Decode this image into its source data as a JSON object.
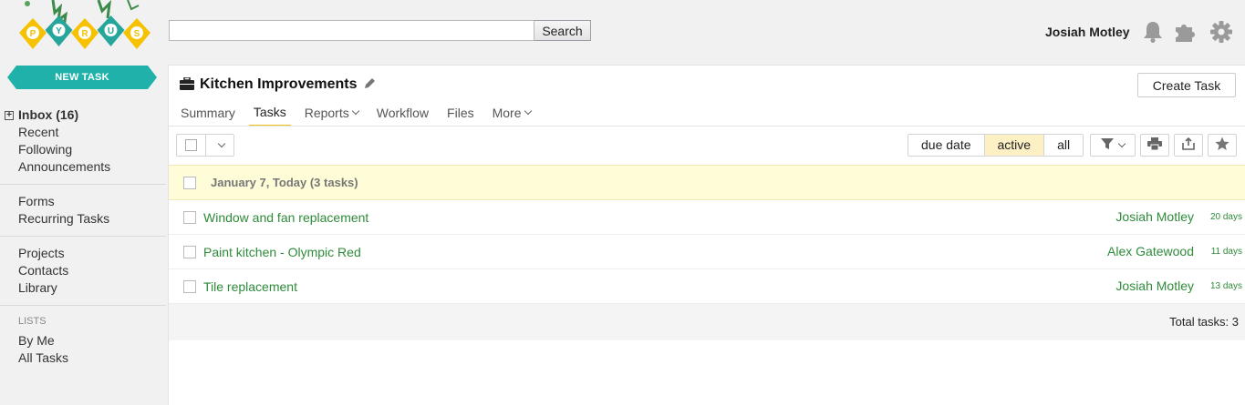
{
  "app": {
    "logo_letters": [
      "P",
      "Y",
      "R",
      "U",
      "S"
    ],
    "colors": {
      "accent": "#20b2aa",
      "task_green": "#2e8b3a",
      "highlight": "#fefdd7",
      "active_seg": "#fdf0c4",
      "logo_yellow": "#f6c200",
      "logo_teal": "#26a69a"
    }
  },
  "header": {
    "search": {
      "value": "",
      "placeholder": "",
      "button_label": "Search"
    },
    "user_name": "Josiah Motley",
    "icons": [
      "bell-icon",
      "puzzle-icon",
      "gear-icon"
    ]
  },
  "sidebar": {
    "new_task_label": "NEW TASK",
    "groups": [
      {
        "items": [
          "Inbox (16)",
          "Recent",
          "Following",
          "Announcements"
        ]
      },
      {
        "items": [
          "Forms",
          "Recurring Tasks"
        ]
      },
      {
        "items": [
          "Projects",
          "Contacts",
          "Library"
        ]
      }
    ],
    "lists_header": "LISTS",
    "lists": [
      "By Me",
      "All Tasks"
    ]
  },
  "project": {
    "title": "Kitchen Improvements",
    "create_task_label": "Create Task",
    "tabs": [
      {
        "label": "Summary",
        "dropdown": false,
        "active": false
      },
      {
        "label": "Tasks",
        "dropdown": false,
        "active": true
      },
      {
        "label": "Reports",
        "dropdown": true,
        "active": false
      },
      {
        "label": "Workflow",
        "dropdown": false,
        "active": false
      },
      {
        "label": "Files",
        "dropdown": false,
        "active": false
      },
      {
        "label": "More",
        "dropdown": true,
        "active": false
      }
    ]
  },
  "toolbar": {
    "sort_options": [
      "due date",
      "active",
      "all"
    ],
    "selected_option": "active",
    "icons": [
      "filter-icon",
      "print-icon",
      "export-icon",
      "star-icon"
    ]
  },
  "task_group": {
    "label": "January 7, Today (3 tasks)",
    "tasks": [
      {
        "name": "Window and fan replacement",
        "assignee": "Josiah Motley",
        "age": "20 days"
      },
      {
        "name": "Paint kitchen - Olympic Red",
        "assignee": "Alex Gatewood",
        "age": "11 days"
      },
      {
        "name": "Tile replacement",
        "assignee": "Josiah Motley",
        "age": "13 days"
      }
    ]
  },
  "footer": {
    "total_label": "Total tasks: 3"
  }
}
